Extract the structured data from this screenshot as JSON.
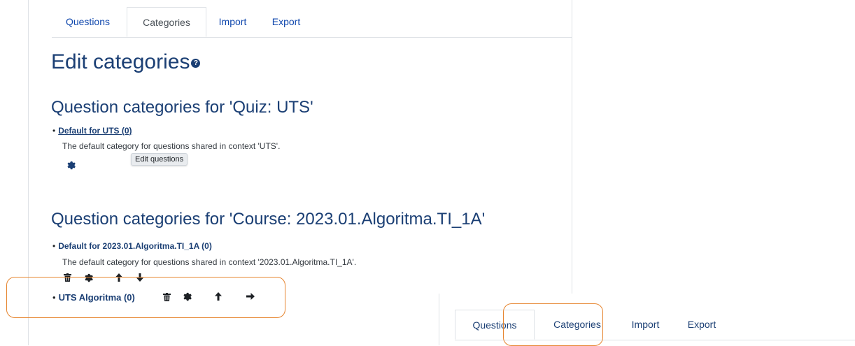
{
  "tabs": [
    "Questions",
    "Categories",
    "Import",
    "Export"
  ],
  "page_title": "Edit categories",
  "sections": [
    {
      "heading": "Question categories for 'Quiz: UTS'",
      "categories": [
        {
          "name": "Default for UTS (0)",
          "description": "The default category for questions shared in context 'UTS'."
        }
      ]
    },
    {
      "heading": "Question categories for 'Course: 2023.01.Algoritma.TI_1A'",
      "categories": [
        {
          "name": "Default for 2023.01.Algoritma.TI_1A (0)",
          "description": "The default category for questions shared in context '2023.01.Algoritma.TI_1A'."
        },
        {
          "name": "UTS Algoritma (0)"
        }
      ]
    }
  ],
  "tooltip": "Edit questions",
  "inset_tabs": [
    "Questions",
    "Categories",
    "Import",
    "Export"
  ],
  "colors": {
    "heading": "#1b3f74",
    "link": "#0f47ad",
    "highlight": "#e6852f"
  },
  "icons": [
    "help-icon",
    "gear-icon",
    "trash-icon",
    "arrow-up-icon",
    "arrow-down-icon",
    "arrow-right-icon"
  ]
}
